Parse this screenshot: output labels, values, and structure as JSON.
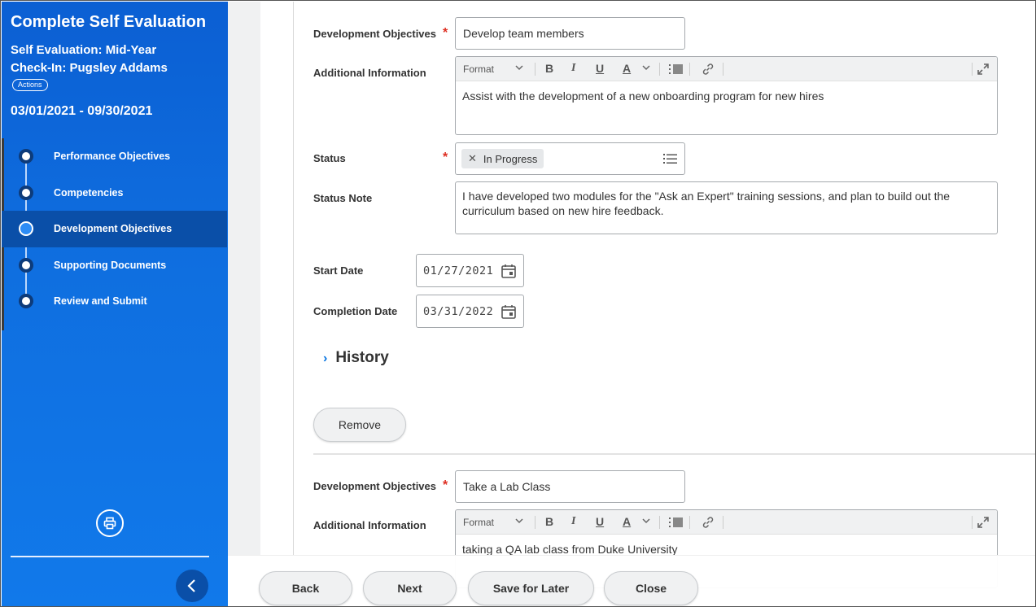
{
  "sidebar": {
    "title": "Complete Self Evaluation",
    "subtitle_line1": "Self Evaluation: Mid-Year",
    "subtitle_line2": "Check-In: Pugsley Addams",
    "actions_label": "Actions",
    "date_range": "03/01/2021 - 09/30/2021",
    "steps": [
      {
        "label": "Performance Objectives"
      },
      {
        "label": "Competencies"
      },
      {
        "label": "Development Objectives",
        "active": true
      },
      {
        "label": "Supporting Documents"
      },
      {
        "label": "Review and Submit"
      }
    ]
  },
  "form": {
    "objective1": {
      "label": "Development Objectives",
      "value": "Develop team members",
      "additional_label": "Additional Information",
      "additional_text": "Assist with the development of a new onboarding program for new hires",
      "status_label": "Status",
      "status_value": "In Progress",
      "status_note_label": "Status Note",
      "status_note_text": "I have developed two modules for the \"Ask an Expert\" training sessions, and plan to build out the curriculum based on new hire feedback.",
      "start_date_label": "Start Date",
      "start_date": "01/27/2021",
      "completion_date_label": "Completion Date",
      "completion_date": "03/31/2022",
      "history_label": "History",
      "remove_label": "Remove"
    },
    "objective2": {
      "label": "Development Objectives",
      "value": "Take a Lab Class",
      "additional_label": "Additional Information",
      "additional_text": "taking a QA lab class from Duke University"
    },
    "editor": {
      "format_label": "Format"
    }
  },
  "footer": {
    "back": "Back",
    "next": "Next",
    "save_for_later": "Save for Later",
    "close": "Close"
  },
  "colors": {
    "sidebar_blue": "#0f6fe0",
    "active_step": "#0a4fa8",
    "required": "#de2e21",
    "link_blue": "#0875e1"
  }
}
